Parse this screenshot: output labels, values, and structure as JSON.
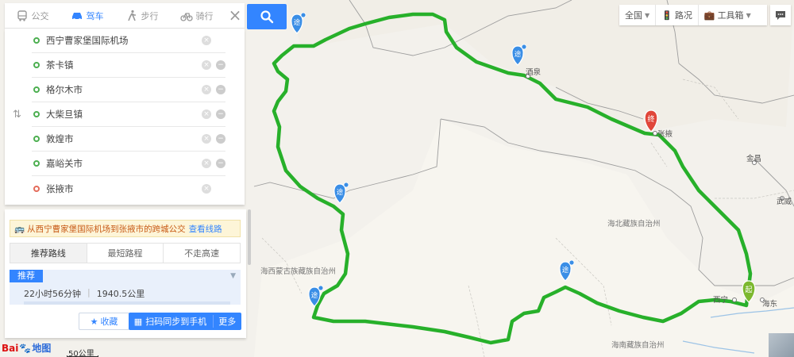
{
  "mode_tabs": [
    {
      "label": "公交",
      "icon": "bus-icon",
      "active": false
    },
    {
      "label": "驾车",
      "icon": "car-icon",
      "active": true
    },
    {
      "label": "步行",
      "icon": "walk-icon",
      "active": false
    },
    {
      "label": "骑行",
      "icon": "bike-icon",
      "active": false
    }
  ],
  "waypoints": [
    {
      "name": "西宁曹家堡国际机场",
      "type": "start"
    },
    {
      "name": "茶卡镇",
      "type": "via"
    },
    {
      "name": "格尔木市",
      "type": "via"
    },
    {
      "name": "大柴旦镇",
      "type": "via"
    },
    {
      "name": "敦煌市",
      "type": "via"
    },
    {
      "name": "嘉峪关市",
      "type": "via"
    },
    {
      "name": "张掖市",
      "type": "end"
    }
  ],
  "result": {
    "transit_tip": "从西宁曹家堡国际机场到张掖市的跨城公交",
    "transit_link": "查看线路",
    "pref_tabs": [
      {
        "label": "推荐路线",
        "active": true
      },
      {
        "label": "最短路程",
        "active": false
      },
      {
        "label": "不走高速",
        "active": false
      }
    ],
    "badge": "推荐",
    "duration": "22小时56分钟",
    "distance": "1940.5公里",
    "favorite_label": "收藏",
    "send_label": "扫码同步到手机",
    "more_label": "更多"
  },
  "toolbar": {
    "region": "全国",
    "traffic": "路况",
    "toolbox": "工具箱"
  },
  "map_labels": {
    "jiuquan": "酒泉",
    "zhangye": "张掖",
    "jinchang": "金昌",
    "wuwei": "武威",
    "xining": "西宁",
    "haidong": "海东",
    "haibei": "海北藏族自治州",
    "haixi": "海西蒙古族藏族自治州",
    "hainan": "海南藏族自治州"
  },
  "markers": {
    "via_label": "途",
    "end_label": "终",
    "start_label": "起"
  },
  "logo": {
    "part1": "Bai",
    "part2": "地图"
  },
  "scale": "50公里",
  "colors": {
    "route": "#27b02a",
    "accent": "#3385ff",
    "end_marker": "#e0463a",
    "start_marker": "#7cb82f"
  }
}
